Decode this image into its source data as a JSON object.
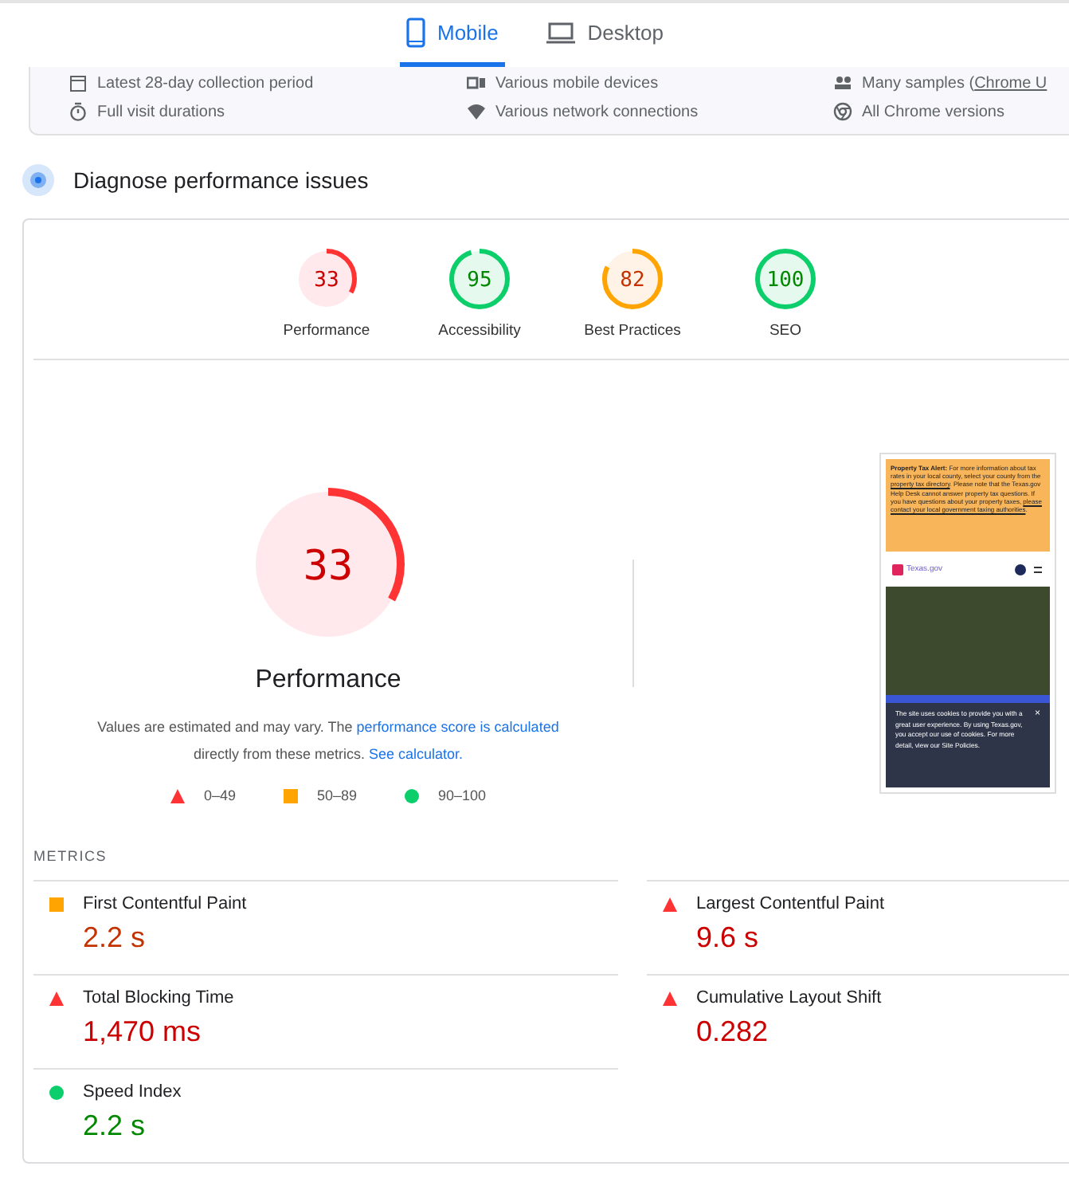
{
  "tabs": [
    {
      "label": "Mobile",
      "selected": true,
      "kind": "phone"
    },
    {
      "label": "Desktop",
      "selected": false,
      "kind": "laptop"
    }
  ],
  "field_summary": [
    {
      "kind": "calendar",
      "text": "Latest 28-day collection period"
    },
    {
      "kind": "devices",
      "text": "Various mobile devices"
    },
    {
      "kind": "people",
      "text": "Many samples (",
      "link": "Chrome U"
    },
    {
      "kind": "timer",
      "text": "Full visit durations"
    },
    {
      "kind": "wifi",
      "text": "Various network connections"
    },
    {
      "kind": "chrome",
      "text": "All Chrome versions"
    }
  ],
  "diagnose": {
    "title": "Diagnose performance issues"
  },
  "categories": [
    {
      "score": "33",
      "label": "Performance",
      "kind": "fail",
      "level": 0.33
    },
    {
      "score": "95",
      "label": "Accessibility",
      "kind": "pass",
      "level": 0.95
    },
    {
      "score": "82",
      "label": "Best Practices",
      "kind": "average",
      "level": 0.82
    },
    {
      "score": "100",
      "label": "SEO",
      "kind": "pass",
      "level": 1
    }
  ],
  "main_gauge": {
    "score": "33",
    "title": "Performance",
    "kind": "fail",
    "level": 0.33
  },
  "note": {
    "before": "Values are estimated and may vary. The ",
    "link1": "performance score is calculated",
    "middle": " directly from these metrics. ",
    "link2": "See calculator."
  },
  "legend": [
    {
      "kind": "fail",
      "text": "0–49"
    },
    {
      "kind": "average",
      "text": "50–89"
    },
    {
      "kind": "pass",
      "text": "90–100"
    }
  ],
  "screenshot": {
    "alert_bold": "Property Tax Alert:",
    "alert_text": " For more information about tax rates in your local county, select your county from the ",
    "alert_link1": "property tax directory",
    "alert_text2": ". Please note that the Texas.gov Help Desk cannot answer property tax questions. If you have questions about your property taxes, ",
    "alert_link2": "please contact your local government taxing authorities",
    "alert_end": ".",
    "site_name": "Texas.gov",
    "cookie_text": "The site uses cookies to provide you with a great user experience. By using Texas.gov, you accept our use of cookies. For more detail, view our Site Policies.",
    "close": "×"
  },
  "metrics": {
    "heading": "METRICS",
    "items": [
      {
        "name": "First Contentful Paint",
        "value": "2.2 s",
        "kind": "average"
      },
      {
        "name": "Largest Contentful Paint",
        "value": "9.6 s",
        "kind": "fail"
      },
      {
        "name": "Total Blocking Time",
        "value": "1,470 ms",
        "kind": "fail"
      },
      {
        "name": "Cumulative Layout Shift",
        "value": "0.282",
        "kind": "fail"
      },
      {
        "name": "Speed Index",
        "value": "2.2 s",
        "kind": "pass"
      }
    ]
  }
}
